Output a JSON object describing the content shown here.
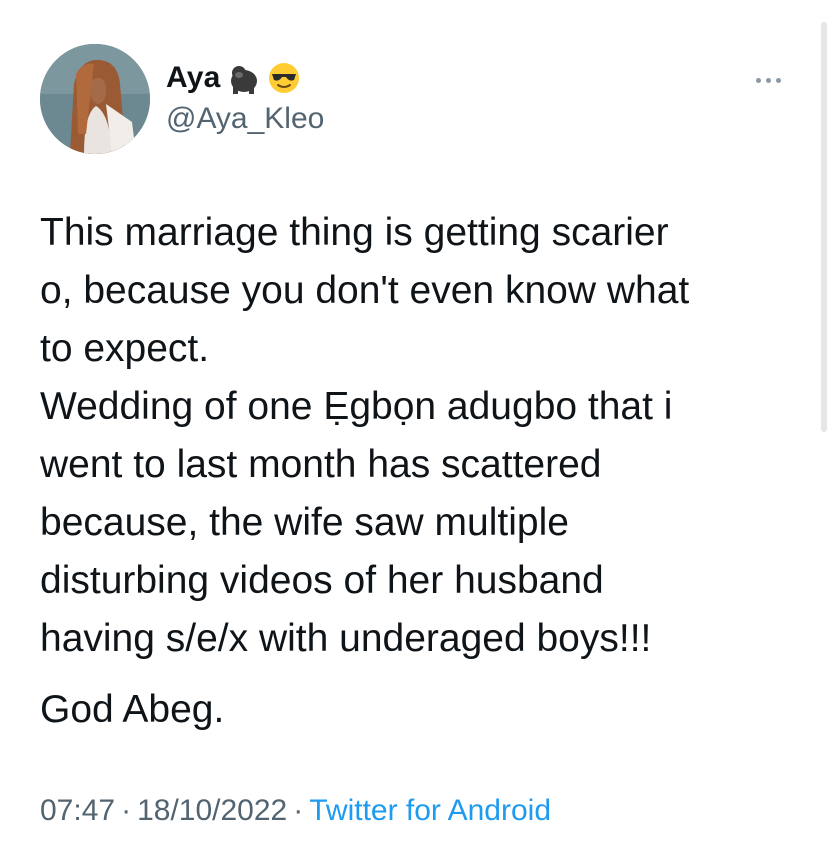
{
  "author": {
    "display_name": "Aya",
    "name_emojis": [
      "gorilla-icon",
      "sunglasses-face-icon"
    ],
    "handle": "@Aya_Kleo"
  },
  "tweet": {
    "lines": [
      "This marriage thing is getting scarier",
      "o, because you don't even know what",
      "to expect.",
      "Wedding of one Ẹgbọn adugbo that i",
      "went to last month has scattered",
      "because, the wife saw multiple",
      "disturbing videos of her husband",
      "having s/e/x with underaged boys!!!"
    ],
    "closing": "God Abeg."
  },
  "meta": {
    "time": "07:47",
    "separator": "·",
    "date": "18/10/2022",
    "source": "Twitter for Android"
  },
  "colors": {
    "text": "#0f1419",
    "secondary": "#536471",
    "link": "#1d9bf0"
  }
}
